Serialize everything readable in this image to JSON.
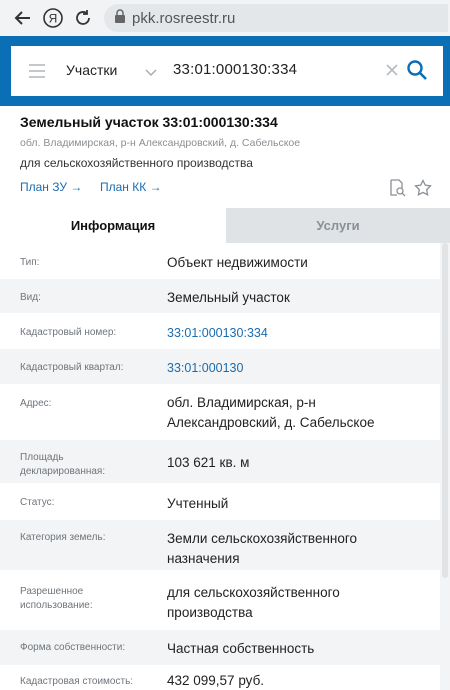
{
  "browser": {
    "url": "pkk.rosreestr.ru"
  },
  "search": {
    "category": "Участки",
    "value": "33:01:000130:334"
  },
  "parcel": {
    "title": "Земельный участок 33:01:000130:334",
    "address": "обл. Владимирская, р-н Александровский, д. Сабельское",
    "purpose": "для сельскохозяйственного производства",
    "plan_zu": "План ЗУ →",
    "plan_kk": "План КК →"
  },
  "tabs": {
    "info": "Информация",
    "services": "Услуги"
  },
  "info_rows": [
    {
      "label": "Тип:",
      "value": "Объект недвижимости"
    },
    {
      "label": "Вид:",
      "value": "Земельный участок"
    },
    {
      "label": "Кадастровый номер:",
      "value": "33:01:000130:334"
    },
    {
      "label": "Кадастровый квартал:",
      "value": "33:01:000130"
    },
    {
      "label": "Адрес:",
      "value": "обл. Владимирская, р-н Александровский, д. Сабельское"
    },
    {
      "label": "Площадь декларированная:",
      "value": "103 621 кв. м"
    },
    {
      "label": "Статус:",
      "value": "Учтенный"
    },
    {
      "label": "Категория земель:",
      "value": "Земли сельскохозяйственного назначения"
    },
    {
      "label": "Разрешенное использование:",
      "value": "для сельскохозяйственного производства"
    },
    {
      "label": "Форма собственности:",
      "value": "Частная собственность"
    },
    {
      "label": "Кадастровая стоимость:",
      "value": "432 099,57 руб."
    }
  ]
}
